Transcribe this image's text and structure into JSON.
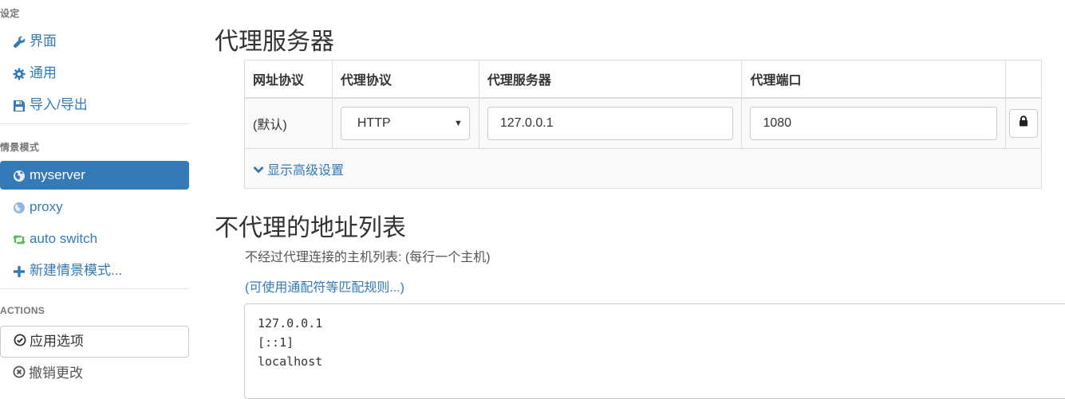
{
  "sidebar": {
    "settings_header": "设定",
    "settings_items": [
      {
        "label": "界面",
        "icon": "wrench-icon"
      },
      {
        "label": "通用",
        "icon": "gear-icon"
      },
      {
        "label": "导入/导出",
        "icon": "floppy-disk-icon"
      }
    ],
    "profiles_header": "情景模式",
    "profiles": [
      {
        "label": "myserver",
        "icon": "globe-icon",
        "active": true
      },
      {
        "label": "proxy",
        "icon": "globe-icon",
        "active": false
      },
      {
        "label": "auto switch",
        "icon": "retweet-icon",
        "active": false
      }
    ],
    "new_profile": "新建情景模式...",
    "actions_header": "ACTIONS",
    "apply_label": "应用选项",
    "discard_label": "撤销更改"
  },
  "main": {
    "proxy_title": "代理服务器",
    "table": {
      "headers": [
        "网址协议",
        "代理协议",
        "代理服务器",
        "代理端口"
      ],
      "row": {
        "scheme": "(默认)",
        "protocol": "HTTP",
        "server": "127.0.0.1",
        "port": "1080"
      },
      "advanced_label": "显示高级设置"
    },
    "bypass_title": "不代理的地址列表",
    "bypass_help": "不经过代理连接的主机列表: (每行一个主机)",
    "wildcard_link": "(可使用通配符等匹配规则...)",
    "bypass_list": "127.0.0.1\n[::1]\nlocalhost"
  },
  "colors": {
    "accent": "#337ab7",
    "auto_switch_icon": "#5cb85c"
  }
}
